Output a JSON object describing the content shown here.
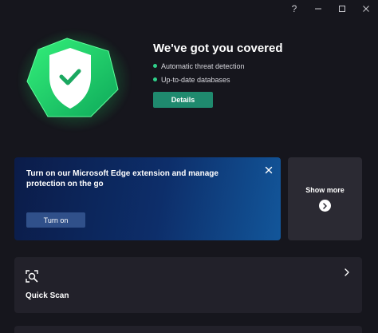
{
  "window": {
    "help_label": "?"
  },
  "hero": {
    "title": "We've got you covered",
    "features": [
      "Automatic threat detection",
      "Up-to-date databases"
    ],
    "details_label": "Details"
  },
  "edge_card": {
    "message": "Turn on our Microsoft Edge extension and manage protection on the go",
    "turn_on_label": "Turn on"
  },
  "more_card": {
    "label": "Show more"
  },
  "quick_scan": {
    "label": "Quick Scan"
  },
  "colors": {
    "background": "#16161d",
    "accent_green": "#2fd08a",
    "details_button": "#1f8a6e",
    "card": "#22212a",
    "edge_gradient_start": "#0b1c49",
    "edge_gradient_end": "#12569a"
  }
}
